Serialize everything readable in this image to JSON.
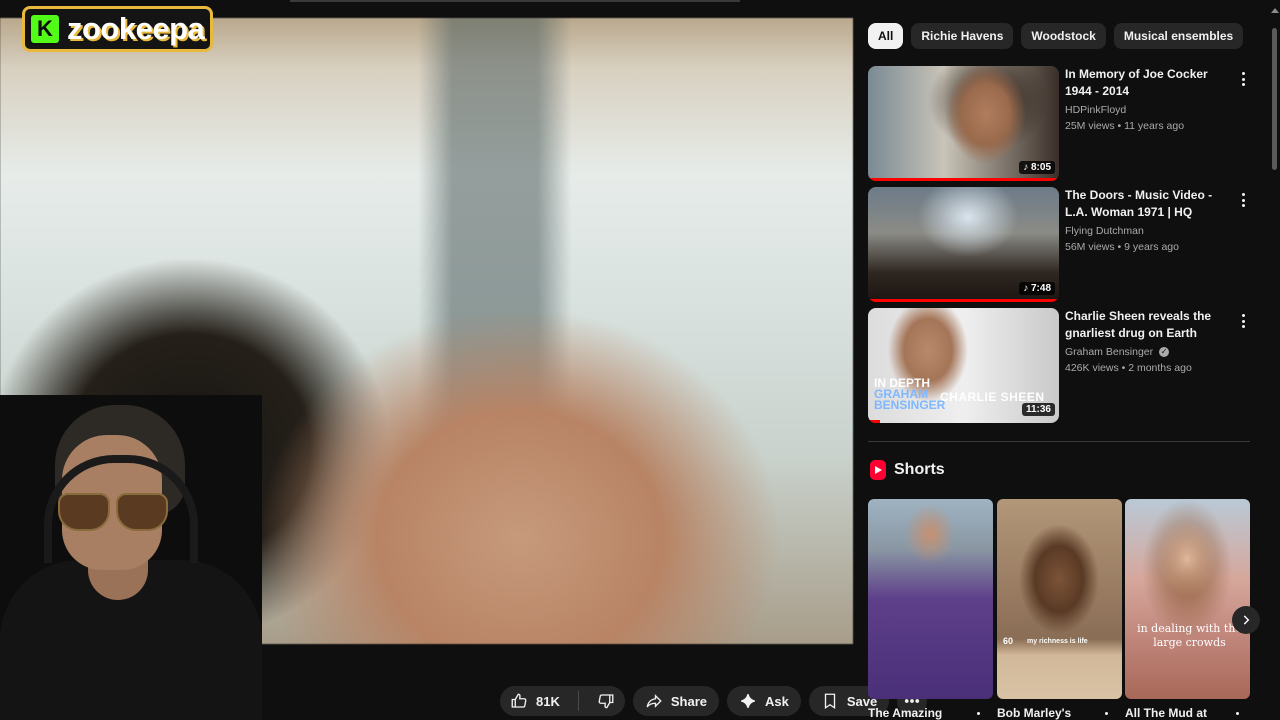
{
  "logo": {
    "badge": "K",
    "text": "zookeepa"
  },
  "actions": {
    "likes": "81K",
    "share": "Share",
    "ask": "Ask",
    "save": "Save"
  },
  "chips": [
    "All",
    "Richie Havens",
    "Woodstock",
    "Musical ensembles"
  ],
  "related": [
    {
      "title": "In Memory of Joe Cocker  1944 - 2014",
      "channel": "HDPinkFloyd",
      "meta": "25M views • 11 years ago",
      "duration": "8:05"
    },
    {
      "title": "The Doors - Music Video - L.A. Woman 1971 | HQ",
      "channel": "Flying Dutchman",
      "meta": "56M views • 9 years ago",
      "duration": "7:48"
    },
    {
      "title": "Charlie Sheen reveals the gnarliest drug on Earth",
      "channel": "Graham Bensinger",
      "meta": "426K views • 2 months ago",
      "duration": "11:36",
      "thumb_text": {
        "line1": "IN DEPTH",
        "line2": "GRAHAM",
        "line3": "BENSINGER",
        "name": "CHARLIE SHEEN"
      }
    }
  ],
  "shorts": {
    "heading": "Shorts",
    "items": [
      {
        "title": "The Amazing"
      },
      {
        "title": "Bob Marley's",
        "caption": "my richness is life",
        "badge": "60"
      },
      {
        "title": "All The Mud at",
        "caption": "in dealing with the large crowds"
      }
    ]
  },
  "colors": {
    "accent_red": "#ff0000",
    "kick_green": "#53fc18",
    "logo_gold": "#e8b93c",
    "chip_bg": "#272727"
  }
}
